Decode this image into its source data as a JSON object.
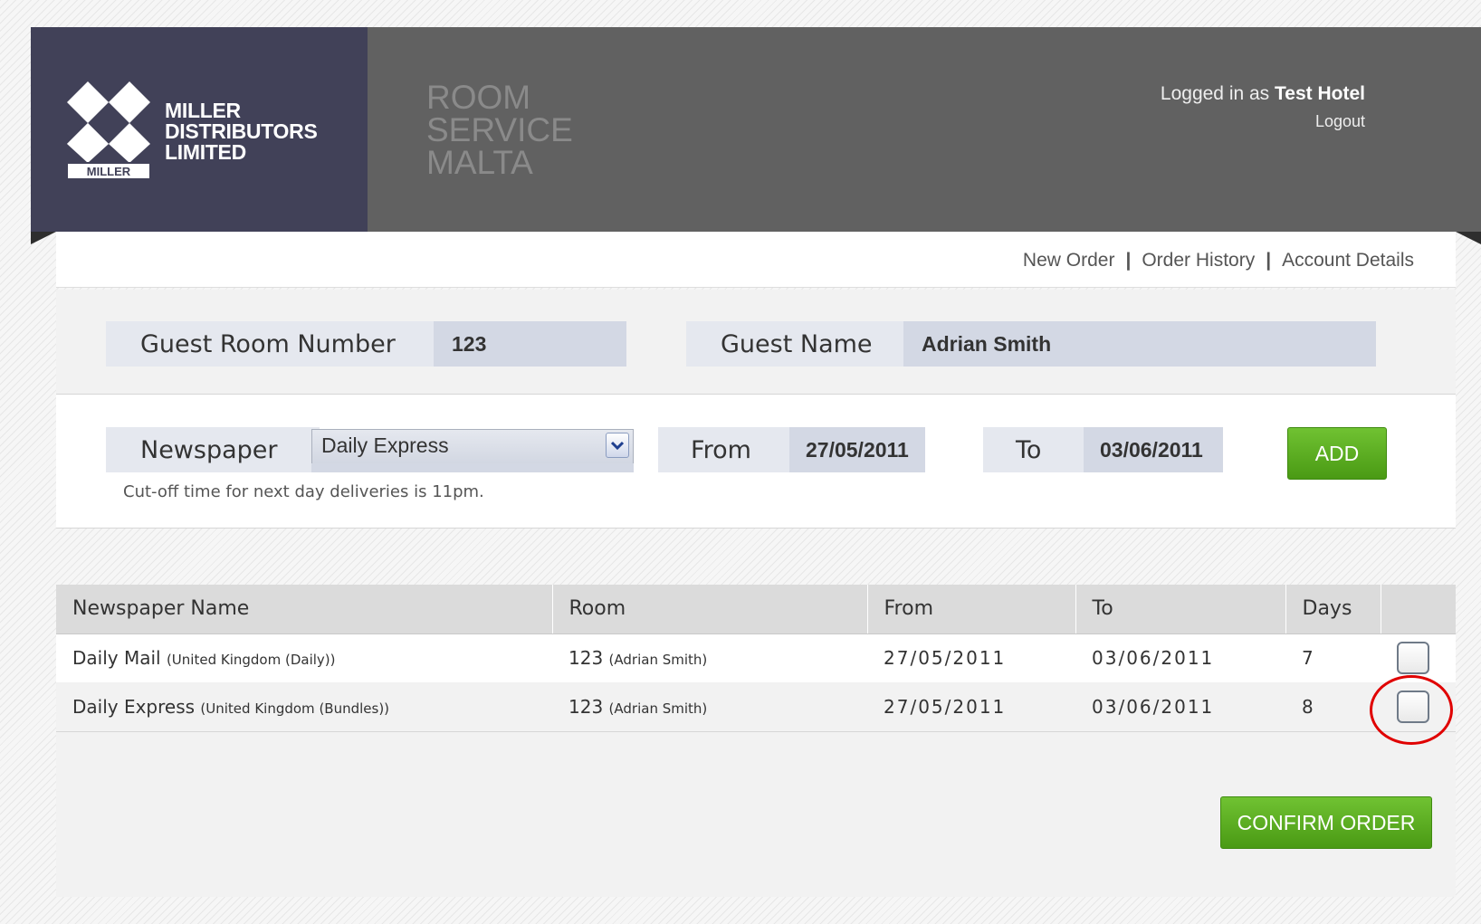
{
  "header": {
    "logo_lines": [
      "MILLER",
      "DISTRIBUTORS",
      "LIMITED"
    ],
    "logo_badge": "MILLER",
    "product_lines": [
      "ROOM",
      "SERVICE",
      "MALTA"
    ],
    "logged_in_prefix": "Logged in as",
    "logged_in_user": "Test Hotel",
    "logout_label": "Logout",
    "brand_color": "#414158"
  },
  "nav": {
    "items": [
      "New Order",
      "Order History",
      "Account Details"
    ],
    "separator": "|"
  },
  "guest": {
    "room_label": "Guest Room Number",
    "room_value": "123",
    "name_label": "Guest Name",
    "name_value": "Adrian Smith"
  },
  "order_form": {
    "newspaper_label": "Newspaper",
    "newspaper_selected": "Daily Express",
    "from_label": "From",
    "from_value": "27/05/2011",
    "to_label": "To",
    "to_value": "03/06/2011",
    "add_label": "ADD",
    "cutoff_note": "Cut-off time for next day deliveries is 11pm."
  },
  "table": {
    "headers": [
      "Newspaper Name",
      "Room",
      "From",
      "To",
      "Days"
    ],
    "rows": [
      {
        "name": "Daily Mail",
        "edition": "(United Kingdom (Daily))",
        "room": "123",
        "guest": "(Adrian Smith)",
        "from": "27/05/2011",
        "to": "03/06/2011",
        "days": "7"
      },
      {
        "name": "Daily Express",
        "edition": "(United Kingdom (Bundles))",
        "room": "123",
        "guest": "(Adrian Smith)",
        "from": "27/05/2011",
        "to": "03/06/2011",
        "days": "8"
      }
    ]
  },
  "confirm_label": "CONFIRM ORDER",
  "accent_color": "#5aaa1e"
}
